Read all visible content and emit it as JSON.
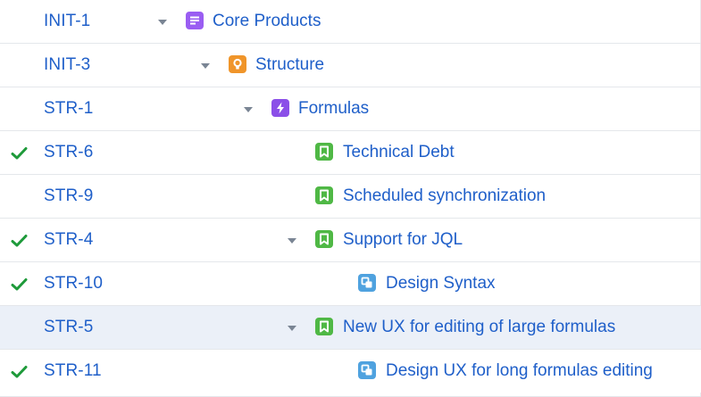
{
  "colors": {
    "link": "#1f5fc9",
    "check": "#1e9a3a",
    "epic": "#9a5df2",
    "initiative": "#f0952a",
    "theme": "#8b4fe8",
    "story": "#4fb845",
    "subtask": "#4fa2df",
    "selected_row": "#ebf0f8"
  },
  "rows": [
    {
      "key": "INIT-1",
      "title": "Core Products",
      "icon": "epic-icon",
      "expanded": true,
      "resolved": false,
      "selected": false
    },
    {
      "key": "INIT-3",
      "title": "Structure",
      "icon": "initiative-icon",
      "expanded": true,
      "resolved": false,
      "selected": false
    },
    {
      "key": "STR-1",
      "title": "Formulas",
      "icon": "theme-icon",
      "expanded": true,
      "resolved": false,
      "selected": false
    },
    {
      "key": "STR-6",
      "title": "Technical Debt",
      "icon": "story-icon",
      "expanded": false,
      "resolved": true,
      "selected": false
    },
    {
      "key": "STR-9",
      "title": "Scheduled synchronization",
      "icon": "story-icon",
      "expanded": false,
      "resolved": false,
      "selected": false
    },
    {
      "key": "STR-4",
      "title": "Support for JQL",
      "icon": "story-icon",
      "expanded": true,
      "resolved": true,
      "selected": false
    },
    {
      "key": "STR-10",
      "title": "Design Syntax",
      "icon": "subtask-icon",
      "expanded": false,
      "resolved": true,
      "selected": false
    },
    {
      "key": "STR-5",
      "title": "New UX for editing of large formulas",
      "icon": "story-icon",
      "expanded": true,
      "resolved": false,
      "selected": true
    },
    {
      "key": "STR-11",
      "title": "Design UX for long formulas editing",
      "icon": "subtask-icon",
      "expanded": false,
      "resolved": true,
      "selected": false
    }
  ]
}
